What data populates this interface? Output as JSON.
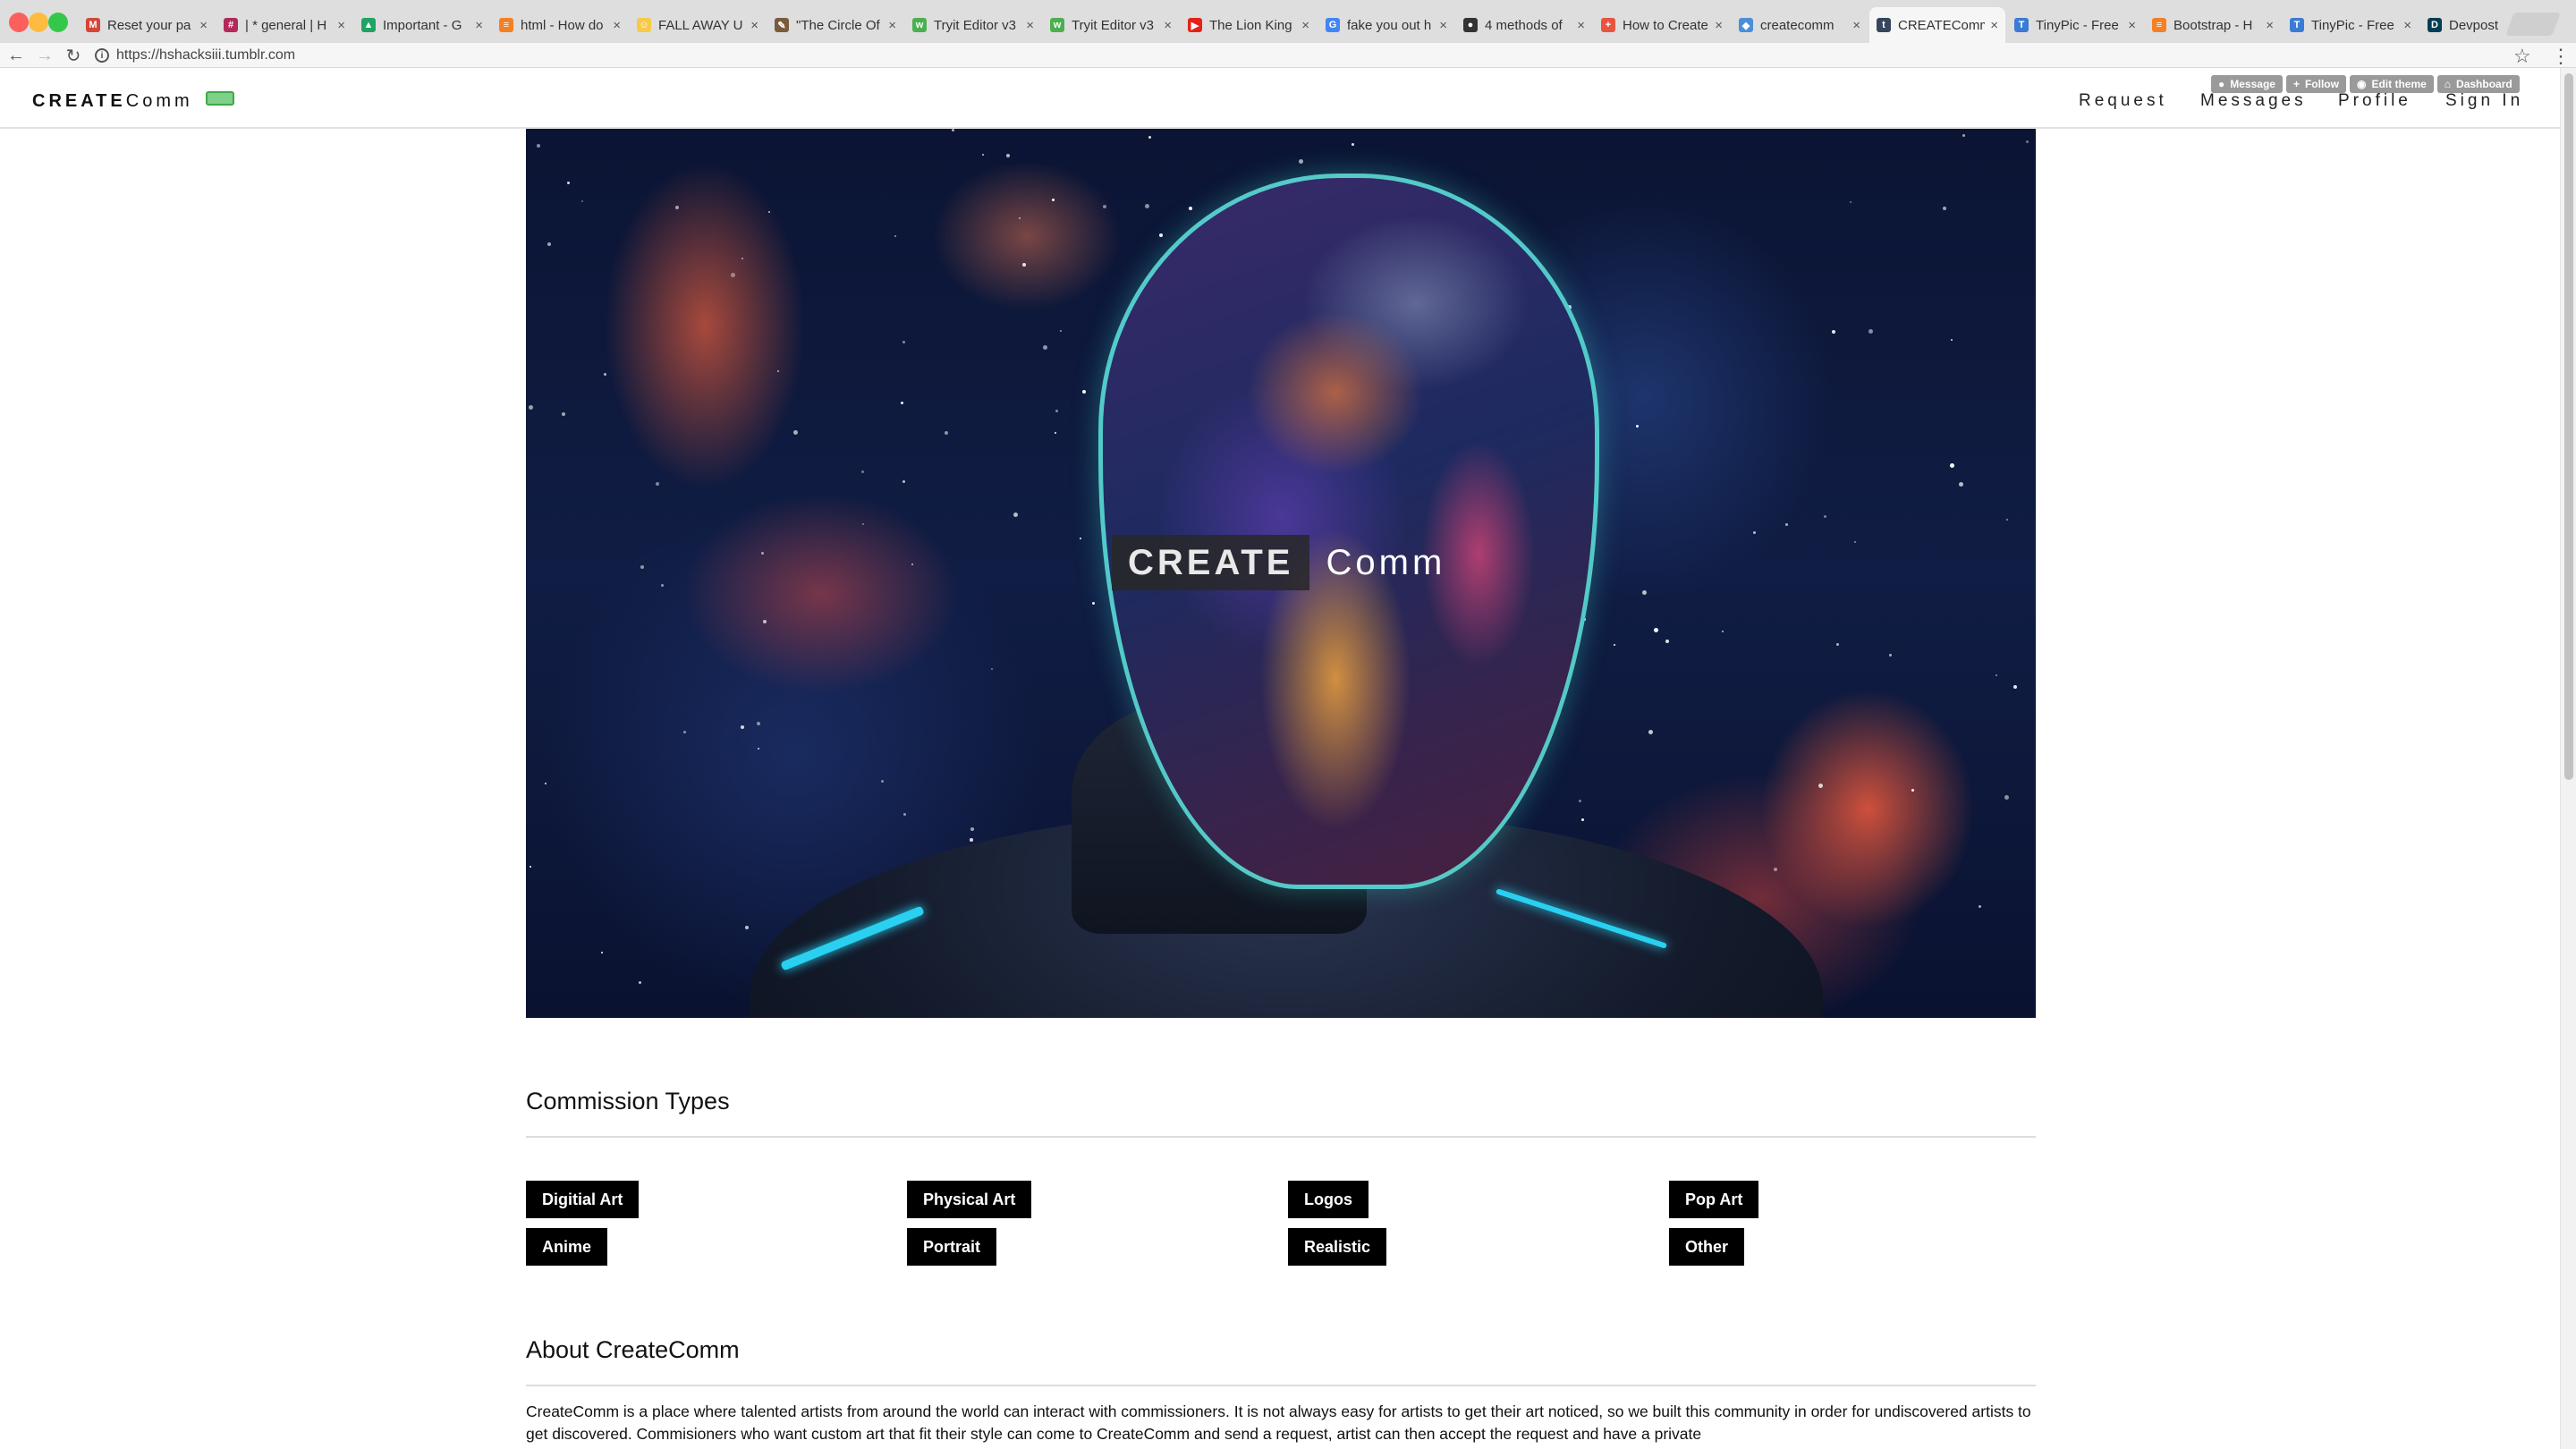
{
  "browser": {
    "tabs": [
      {
        "title": "Reset your pa",
        "fav_color": "#d44638",
        "fav_glyph": "M"
      },
      {
        "title": "| * general | H",
        "fav_color": "#b12a5b",
        "fav_glyph": "#"
      },
      {
        "title": "Important - G",
        "fav_color": "#1fa463",
        "fav_glyph": "▲"
      },
      {
        "title": "html - How do",
        "fav_color": "#f48024",
        "fav_glyph": "≡"
      },
      {
        "title": "FALL AWAY U",
        "fav_color": "#f7c948",
        "fav_glyph": "☺"
      },
      {
        "title": "\"The Circle Of",
        "fav_color": "#7a5c3c",
        "fav_glyph": "✎"
      },
      {
        "title": "Tryit Editor v3",
        "fav_color": "#4caf50",
        "fav_glyph": "w"
      },
      {
        "title": "Tryit Editor v3",
        "fav_color": "#4caf50",
        "fav_glyph": "w"
      },
      {
        "title": "The Lion King",
        "fav_color": "#e62117",
        "fav_glyph": "▶"
      },
      {
        "title": "fake you out h",
        "fav_color": "#4285f4",
        "fav_glyph": "G"
      },
      {
        "title": "4 methods of",
        "fav_color": "#333333",
        "fav_glyph": "●"
      },
      {
        "title": "How to Create",
        "fav_color": "#e8543f",
        "fav_glyph": "+"
      },
      {
        "title": "createcomm",
        "fav_color": "#4a90d9",
        "fav_glyph": "◆"
      },
      {
        "title": "CREATEComm",
        "fav_color": "#36465d",
        "fav_glyph": "t"
      },
      {
        "title": "TinyPic - Free",
        "fav_color": "#3a7bd5",
        "fav_glyph": "T"
      },
      {
        "title": "Bootstrap - H",
        "fav_color": "#f48024",
        "fav_glyph": "≡"
      },
      {
        "title": "TinyPic - Free",
        "fav_color": "#3a7bd5",
        "fav_glyph": "T"
      },
      {
        "title": "Devpost",
        "fav_color": "#003e54",
        "fav_glyph": "D"
      }
    ],
    "active_tab_index": 13,
    "url": "https://hshacksiii.tumblr.com"
  },
  "tumblr_controls": [
    {
      "icon": "chat-bubble",
      "label": "Message"
    },
    {
      "icon": "plus",
      "label": "Follow"
    },
    {
      "icon": "eye",
      "label": "Edit theme"
    },
    {
      "icon": "home",
      "label": "Dashboard"
    }
  ],
  "header": {
    "logo_bold": "CREATE",
    "logo_light": "Comm",
    "nav": [
      "Request",
      "Messages",
      "Profile",
      "Sign In"
    ]
  },
  "hero": {
    "title_bold": "CREATE",
    "title_light": "Comm"
  },
  "commission_section": {
    "title": "Commission Types",
    "types": [
      "Digitial Art",
      "Physical Art",
      "Logos",
      "Pop Art",
      "Anime",
      "Portrait",
      "Realistic",
      "Other"
    ]
  },
  "about_section": {
    "title": "About CreateComm",
    "text": "CreateComm is a place where talented artists from around the world can interact with commissioners. It is not always easy for artists to get their art noticed, so we built this community in order for undiscovered artists to get discovered. Commisioners who want custom art that fit their style can come to CreateComm and send a request, artist can then accept the request and have a private"
  },
  "colors": {
    "accent_badge": "#7fd08a",
    "tag_bg": "#000000",
    "tumblr_control_bg": "#9a9a9a"
  }
}
